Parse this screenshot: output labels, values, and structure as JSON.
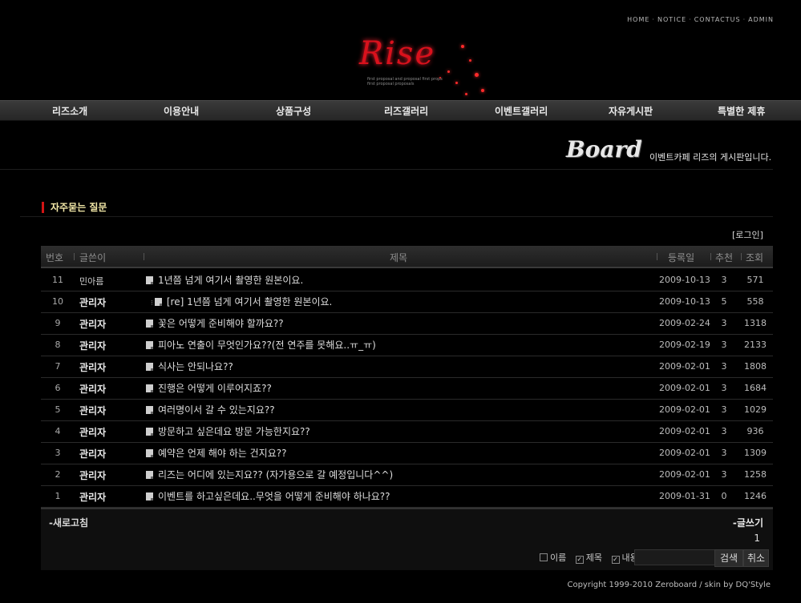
{
  "top_links": [
    "HOME",
    "NOTICE",
    "CONTACTUS",
    "ADMIN"
  ],
  "logo": {
    "text": "Rise",
    "tagline": "first proposal and proposal first props first proposal proposals"
  },
  "nav": [
    "리즈소개",
    "이용안내",
    "상품구성",
    "리즈갤러리",
    "이벤트갤러리",
    "자유게시판",
    "특별한 제휴"
  ],
  "board": {
    "title": "Board",
    "description": "이벤트카페 리즈의 게시판입니다."
  },
  "section_title": "자주묻는 질문",
  "login_label": "[로그인]",
  "table": {
    "headers": {
      "num": "번호",
      "author": "글쓴이",
      "subject": "제목",
      "date": "등록일",
      "vote": "추천",
      "views": "조회"
    },
    "rows": [
      {
        "num": "11",
        "author": "민아름",
        "subject": "1년쯤 넘게 여기서 촬영한 원본이요.",
        "date": "2009-10-13",
        "vote": "3",
        "views": "571",
        "reply": false,
        "bold": false
      },
      {
        "num": "10",
        "author": "관리자",
        "subject": "[re] 1년쯤 넘게 여기서 촬영한 원본이요.",
        "date": "2009-10-13",
        "vote": "5",
        "views": "558",
        "reply": true,
        "bold": true
      },
      {
        "num": "9",
        "author": "관리자",
        "subject": "꽃은 어떻게 준비해야 할까요??",
        "date": "2009-02-24",
        "vote": "3",
        "views": "1318",
        "reply": false,
        "bold": true
      },
      {
        "num": "8",
        "author": "관리자",
        "subject": "피아노 연출이 무엇인가요??(전 연주를 못해요..ㅠ_ㅠ)",
        "date": "2009-02-19",
        "vote": "3",
        "views": "2133",
        "reply": false,
        "bold": true
      },
      {
        "num": "7",
        "author": "관리자",
        "subject": "식사는 안되나요??",
        "date": "2009-02-01",
        "vote": "3",
        "views": "1808",
        "reply": false,
        "bold": true
      },
      {
        "num": "6",
        "author": "관리자",
        "subject": "진행은 어떻게 이루어지죠??",
        "date": "2009-02-01",
        "vote": "3",
        "views": "1684",
        "reply": false,
        "bold": true
      },
      {
        "num": "5",
        "author": "관리자",
        "subject": "여러명이서 갈 수 있는지요??",
        "date": "2009-02-01",
        "vote": "3",
        "views": "1029",
        "reply": false,
        "bold": true
      },
      {
        "num": "4",
        "author": "관리자",
        "subject": "방문하고 싶은데요 방문 가능한지요??",
        "date": "2009-02-01",
        "vote": "3",
        "views": "936",
        "reply": false,
        "bold": true
      },
      {
        "num": "3",
        "author": "관리자",
        "subject": "예약은 언제 해야 하는 건지요??",
        "date": "2009-02-01",
        "vote": "3",
        "views": "1309",
        "reply": false,
        "bold": true
      },
      {
        "num": "2",
        "author": "관리자",
        "subject": "리즈는 어디에 있는지요?? (자가용으로 갈 예정입니다^^)",
        "date": "2009-02-01",
        "vote": "3",
        "views": "1258",
        "reply": false,
        "bold": true
      },
      {
        "num": "1",
        "author": "관리자",
        "subject": "이벤트를 하고싶은데요..무엇을 어떻게 준비해야 하나요??",
        "date": "2009-01-31",
        "vote": "0",
        "views": "1246",
        "reply": false,
        "bold": true
      }
    ]
  },
  "footer": {
    "refresh": "-새로고침",
    "write": "-글쓰기",
    "page": "1",
    "options": {
      "name": "이름",
      "subject": "제목",
      "content": "내용"
    },
    "search_button": "검색",
    "cancel_button": "취소"
  },
  "copyright": "Copyright 1999-2010 Zeroboard / skin by DQ'Style"
}
